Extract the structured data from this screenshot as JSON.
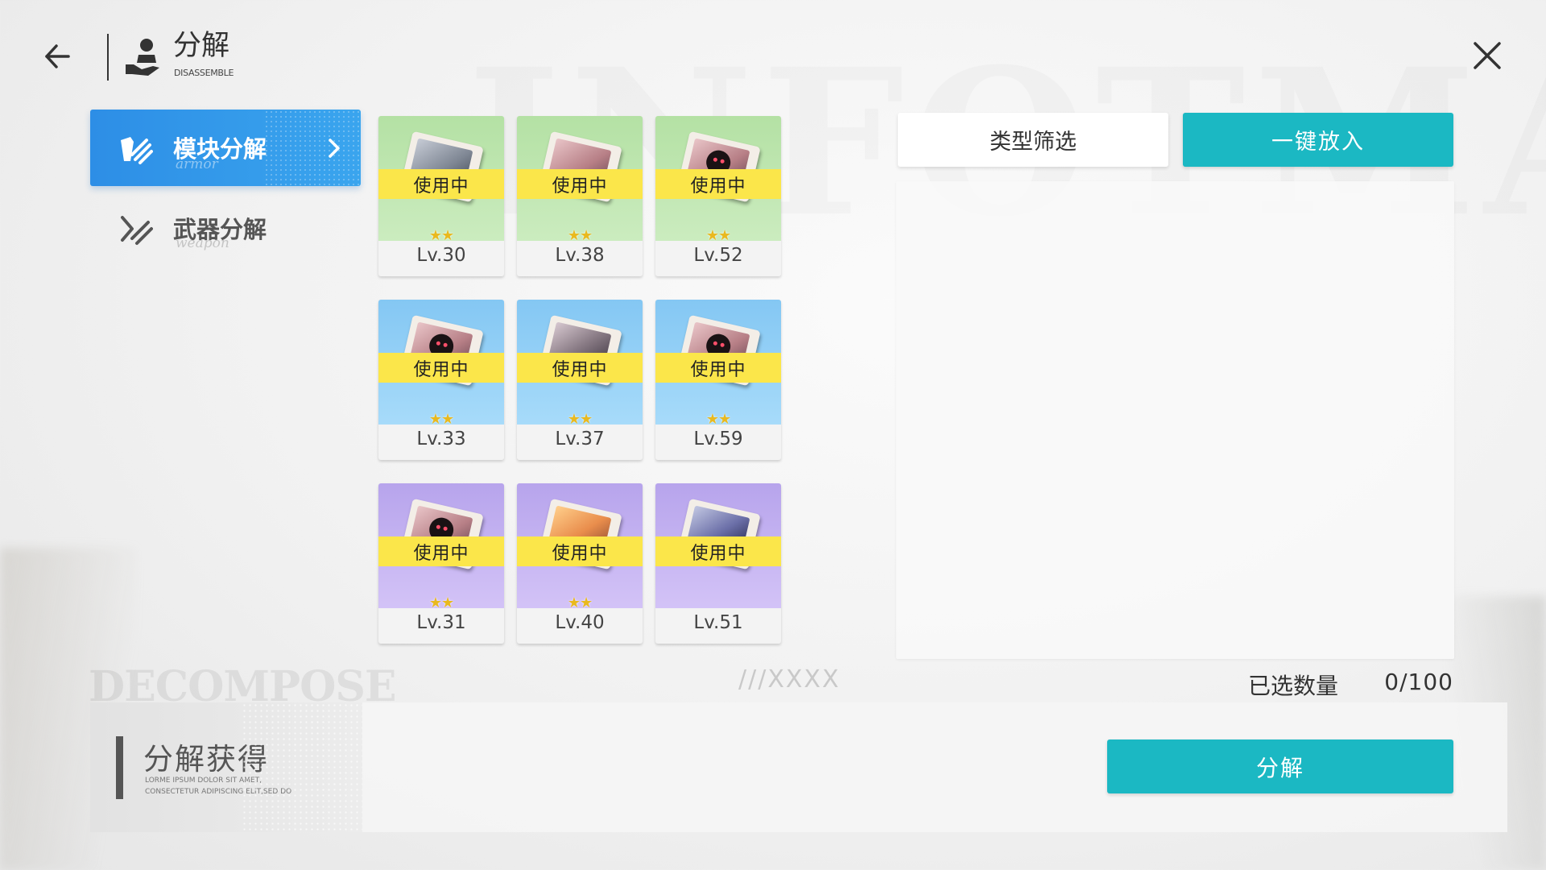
{
  "background": {
    "watermark": "INFOTMA",
    "decompose_watermark": "DECOMPOSE",
    "deco_slashes": "///XXXX"
  },
  "header": {
    "title": "分解",
    "subtitle": "DISASSEMBLE",
    "back_icon": "back-arrow-icon",
    "close_icon": "close-icon"
  },
  "sidebar": {
    "items": [
      {
        "label": "模块分解",
        "sublabel": "armor",
        "icon": "armor-module-icon",
        "active": true
      },
      {
        "label": "武器分解",
        "sublabel": "weapon",
        "icon": "weapon-slash-icon",
        "active": false
      }
    ]
  },
  "modules": [
    {
      "status": "使用中",
      "stars": "★★",
      "level": "Lv.30",
      "rarity": "green",
      "art": "grey"
    },
    {
      "status": "使用中",
      "stars": "★★",
      "level": "Lv.38",
      "rarity": "green",
      "art": "pink"
    },
    {
      "status": "使用中",
      "stars": "★★",
      "level": "Lv.52",
      "rarity": "green",
      "art": "face"
    },
    {
      "status": "使用中",
      "stars": "★★",
      "level": "Lv.33",
      "rarity": "blue",
      "art": "face"
    },
    {
      "status": "使用中",
      "stars": "★★",
      "level": "Lv.37",
      "rarity": "blue",
      "art": "dark"
    },
    {
      "status": "使用中",
      "stars": "★★",
      "level": "Lv.59",
      "rarity": "blue",
      "art": "face"
    },
    {
      "status": "使用中",
      "stars": "★★",
      "level": "Lv.31",
      "rarity": "purple",
      "art": "face"
    },
    {
      "status": "使用中",
      "stars": "★★",
      "level": "Lv.40",
      "rarity": "purple",
      "art": "orange"
    },
    {
      "status": "使用中",
      "stars": "",
      "level": "Lv.51",
      "rarity": "purple",
      "art": "navy"
    }
  ],
  "panel": {
    "filter_label": "类型筛选",
    "quick_add_label": "一键放入",
    "count_label": "已选数量",
    "count_value": "0/100"
  },
  "rewards": {
    "title": "分解获得",
    "lorem_line1": "LORME IPSUM DOLOR SIT AMET,",
    "lorem_line2": "CONSECTETUR ADIPISCING ELIT,SED DO"
  },
  "actions": {
    "disassemble_label": "分解"
  },
  "colors": {
    "accent_teal": "#1bb8c3",
    "active_tab_blue": "#2d8ee6",
    "badge_yellow": "#fbe64a",
    "rarity_green": "#b4e1a4",
    "rarity_blue": "#84c7f3",
    "rarity_purple": "#b7a4ec"
  }
}
